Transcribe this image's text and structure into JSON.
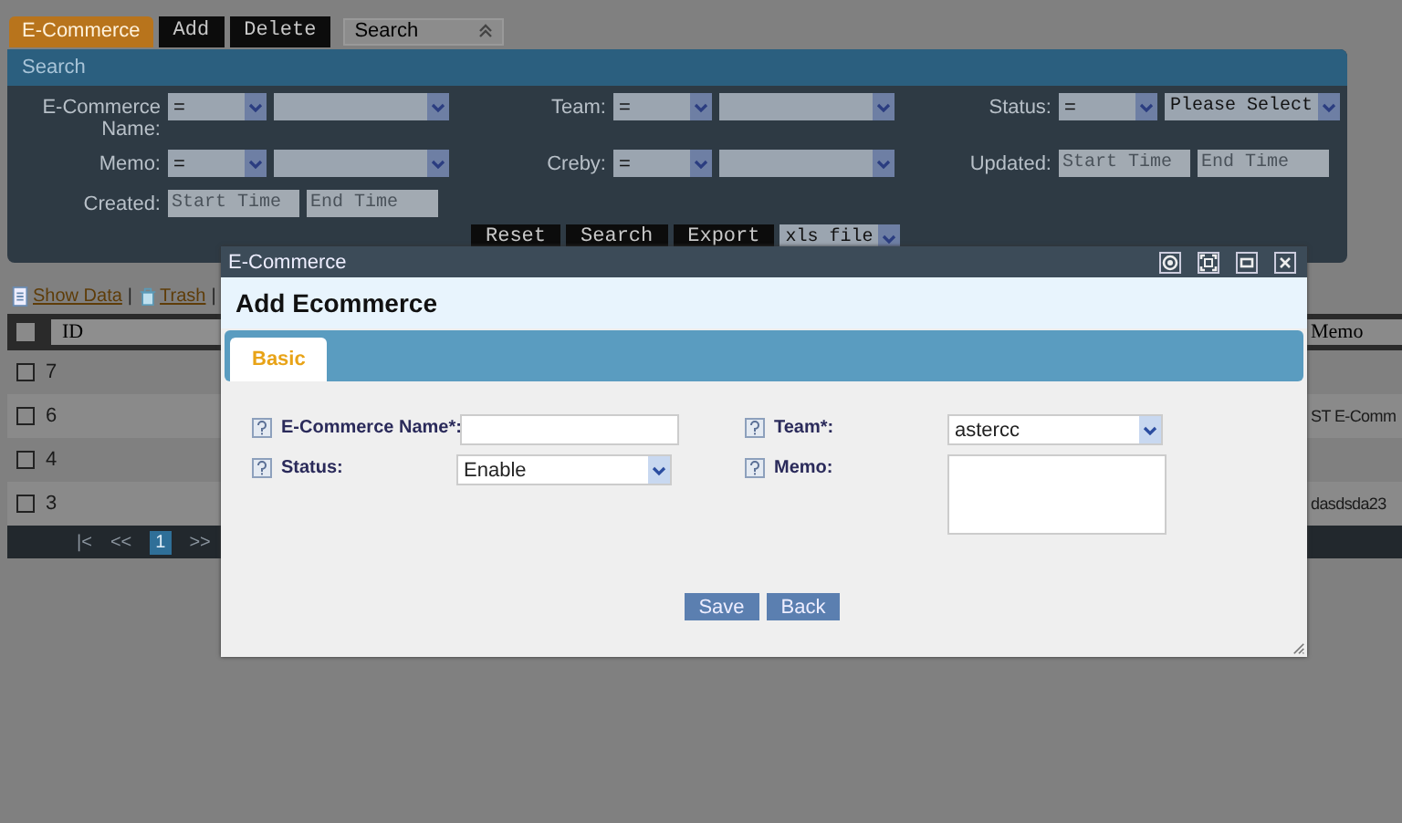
{
  "toolbar": {
    "tabs": [
      {
        "label": "E-Commerce",
        "selected": true
      },
      {
        "label": "Add",
        "selected": false
      },
      {
        "label": "Delete",
        "selected": false
      }
    ],
    "search_toggle": {
      "label": "Search",
      "expanded": true
    }
  },
  "search_panel": {
    "title": "Search",
    "fields": [
      {
        "label": "E-Commerce Name:",
        "kind": "select",
        "operator": "="
      },
      {
        "label": "Team:",
        "kind": "select",
        "operator": "="
      },
      {
        "label": "Status:",
        "kind": "select",
        "operator": "=",
        "value": "Please Select"
      },
      {
        "label": "Memo:",
        "kind": "select",
        "operator": "="
      },
      {
        "label": "Creby:",
        "kind": "select",
        "operator": "="
      },
      {
        "label": "Updated:",
        "kind": "date",
        "start_placeholder": "Start Time",
        "end_placeholder": "End Time"
      },
      {
        "label": "Created:",
        "kind": "date",
        "start_placeholder": "Start Time",
        "end_placeholder": "End Time"
      }
    ],
    "buttons": [
      "Reset",
      "Search",
      "Export"
    ],
    "export_format": "xls file"
  },
  "links": [
    {
      "label": "Show Data",
      "kind": "data",
      "separator": "|"
    },
    {
      "label": "Trash",
      "kind": "trash",
      "separator": "|"
    }
  ],
  "table": {
    "columns": [
      "ID",
      "Memo"
    ],
    "all_checked": false,
    "rows": [
      {
        "id": "7",
        "checked": false
      },
      {
        "id": "6",
        "memo": "ST E-Comm",
        "checked": false
      },
      {
        "id": "4",
        "checked": false
      },
      {
        "id": "3",
        "memo": "dasdsda23",
        "checked": false
      }
    ]
  },
  "pager": {
    "first": "|<",
    "prev": "<<",
    "pages": [
      {
        "label": "1",
        "selected": true
      }
    ],
    "next": ">>"
  },
  "dialog": {
    "title": "E-Commerce",
    "heading": "Add Ecommerce",
    "tabs": [
      {
        "label": "Basic",
        "selected": true
      }
    ],
    "fields": [
      {
        "label": "E-Commerce Name*:",
        "kind": "text"
      },
      {
        "label": "Team*:",
        "kind": "select",
        "value": "astercc"
      },
      {
        "label": "Status:",
        "kind": "select",
        "value": "Enable"
      },
      {
        "label": "Memo:",
        "kind": "textarea"
      }
    ],
    "buttons": [
      "Save",
      "Back"
    ]
  }
}
